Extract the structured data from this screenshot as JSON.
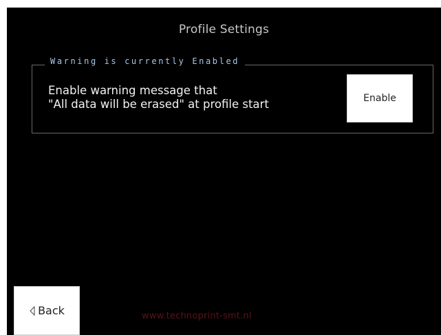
{
  "header": {
    "title": "Profile Settings"
  },
  "warning": {
    "status_label": "Warning is currently Enabled",
    "description_line1": "Enable warning message that",
    "description_line2": "\"All data will be erased\" at profile start",
    "enable_button_label": "Enable"
  },
  "footer": {
    "back_label": "Back",
    "back_icon": "chevron-left-icon",
    "url": "www.technoprint-smt.nl"
  },
  "colors": {
    "screen_background": "#000000",
    "legend_text": "#a8c8e8",
    "footer_url": "#5a1418",
    "button_background": "#ffffff"
  }
}
